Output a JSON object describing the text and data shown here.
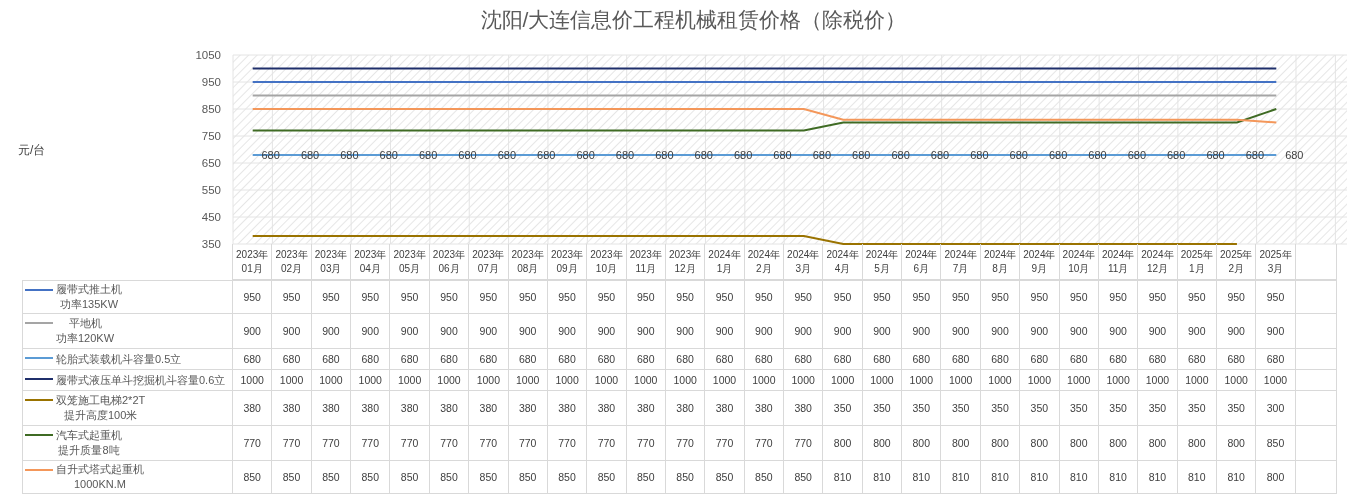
{
  "chart": {
    "chart_data": {
      "type": "line",
      "title": "沈阳/大连信息价工程机械租赁价格（除税价）",
      "annotations": [
        {
          "text": "元/台"
        }
      ],
      "ylim": [
        350,
        1050
      ],
      "yticks": [
        350,
        450,
        550,
        650,
        750,
        850,
        950,
        1050
      ],
      "grid": true,
      "legend": "bottom",
      "categories": [
        "2023年\n01月",
        "2023年\n02月",
        "2023年\n03月",
        "2023年\n04月",
        "2023年\n05月",
        "2023年\n06月",
        "2023年\n07月",
        "2023年\n08月",
        "2023年\n09月",
        "2023年\n10月",
        "2023年\n11月",
        "2023年\n12月",
        "2024年\n1月",
        "2024年\n2月",
        "2024年\n3月",
        "2024年\n4月",
        "2024年\n5月",
        "2024年\n6月",
        "2024年\n7月",
        "2024年\n8月",
        "2024年\n9月",
        "2024年\n10月",
        "2024年\n11月",
        "2024年\n12月",
        "2025年\n1月",
        "2025年\n2月",
        "2025年\n3月"
      ],
      "series": [
        {
          "name": "履带式推土机",
          "color": "#4472c4",
          "values": [
            950,
            950,
            950,
            950,
            950,
            950,
            950,
            950,
            950,
            950,
            950,
            950,
            950,
            950,
            950,
            950,
            950,
            950,
            950,
            950,
            950,
            950,
            950,
            950,
            950,
            950,
            950
          ]
        },
        {
          "name": "平地机",
          "color": "#a5a5a5",
          "values": [
            900,
            900,
            900,
            900,
            900,
            900,
            900,
            900,
            900,
            900,
            900,
            900,
            900,
            900,
            900,
            900,
            900,
            900,
            900,
            900,
            900,
            900,
            900,
            900,
            900,
            900,
            900
          ]
        },
        {
          "name": "轮胎式装载机斗容量0.5立",
          "color": "#5b9bd5",
          "values": [
            680,
            680,
            680,
            680,
            680,
            680,
            680,
            680,
            680,
            680,
            680,
            680,
            680,
            680,
            680,
            680,
            680,
            680,
            680,
            680,
            680,
            680,
            680,
            680,
            680,
            680,
            680
          ],
          "value_labels": [
            "680",
            "680",
            "680",
            "680",
            "680",
            "680",
            "680",
            "680",
            "680",
            "680",
            "680",
            "680",
            "680",
            "680",
            "680",
            "680",
            "680",
            "680",
            "680",
            "680",
            "680",
            "680",
            "680",
            "680",
            "680",
            "680",
            "680"
          ]
        },
        {
          "name": "履带式液压单斗挖掘机斗容量0.6立",
          "color": "#1f2f6b",
          "values": [
            1000,
            1000,
            1000,
            1000,
            1000,
            1000,
            1000,
            1000,
            1000,
            1000,
            1000,
            1000,
            1000,
            1000,
            1000,
            1000,
            1000,
            1000,
            1000,
            1000,
            1000,
            1000,
            1000,
            1000,
            1000,
            1000,
            1000
          ]
        },
        {
          "name": "双笼施工电梯2*2T",
          "color": "#9a7300",
          "values": [
            380,
            380,
            380,
            380,
            380,
            380,
            380,
            380,
            380,
            380,
            380,
            380,
            380,
            380,
            380,
            350,
            350,
            350,
            350,
            350,
            350,
            350,
            350,
            350,
            350,
            350,
            null
          ]
        },
        {
          "name": "汽车式起重机",
          "color": "#3f6b24",
          "values": [
            770,
            770,
            770,
            770,
            770,
            770,
            770,
            770,
            770,
            770,
            770,
            770,
            770,
            770,
            770,
            800,
            800,
            800,
            800,
            800,
            800,
            800,
            800,
            800,
            800,
            800,
            850
          ]
        },
        {
          "name": "自升式塔式起重机",
          "color": "#f4975a",
          "values": [
            850,
            850,
            850,
            850,
            850,
            850,
            850,
            850,
            850,
            850,
            850,
            850,
            850,
            850,
            850,
            810,
            810,
            810,
            810,
            810,
            810,
            810,
            810,
            810,
            810,
            810,
            800
          ]
        }
      ]
    }
  },
  "data_table": {
    "rows": [
      {
        "note": "功率135KW",
        "cells": [
          "950",
          "950",
          "950",
          "950",
          "950",
          "950",
          "950",
          "950",
          "950",
          "950",
          "950",
          "950",
          "950",
          "950",
          "950",
          "950",
          "950",
          "950",
          "950",
          "950",
          "950",
          "950",
          "950",
          "950",
          "950",
          "950",
          "950"
        ]
      },
      {
        "note": "功率120KW",
        "cells": [
          "900",
          "900",
          "900",
          "900",
          "900",
          "900",
          "900",
          "900",
          "900",
          "900",
          "900",
          "900",
          "900",
          "900",
          "900",
          "900",
          "900",
          "900",
          "900",
          "900",
          "900",
          "900",
          "900",
          "900",
          "900",
          "900",
          "900"
        ]
      },
      {
        "cells": [
          "680",
          "680",
          "680",
          "680",
          "680",
          "680",
          "680",
          "680",
          "680",
          "680",
          "680",
          "680",
          "680",
          "680",
          "680",
          "680",
          "680",
          "680",
          "680",
          "680",
          "680",
          "680",
          "680",
          "680",
          "680",
          "680",
          "680"
        ]
      },
      {
        "cells": [
          "1000",
          "1000",
          "1000",
          "1000",
          "1000",
          "1000",
          "1000",
          "1000",
          "1000",
          "1000",
          "1000",
          "1000",
          "1000",
          "1000",
          "1000",
          "1000",
          "1000",
          "1000",
          "1000",
          "1000",
          "1000",
          "1000",
          "1000",
          "1000",
          "1000",
          "1000",
          "1000"
        ]
      },
      {
        "note": "提升高度100米",
        "cells": [
          "380",
          "380",
          "380",
          "380",
          "380",
          "380",
          "380",
          "380",
          "380",
          "380",
          "380",
          "380",
          "380",
          "380",
          "380",
          "350",
          "350",
          "350",
          "350",
          "350",
          "350",
          "350",
          "350",
          "350",
          "350",
          "350",
          "300"
        ]
      },
      {
        "note": "提升质量8吨",
        "cells": [
          "770",
          "770",
          "770",
          "770",
          "770",
          "770",
          "770",
          "770",
          "770",
          "770",
          "770",
          "770",
          "770",
          "770",
          "770",
          "800",
          "800",
          "800",
          "800",
          "800",
          "800",
          "800",
          "800",
          "800",
          "800",
          "800",
          "850"
        ]
      },
      {
        "note": "1000KN.M",
        "cells": [
          "850",
          "850",
          "850",
          "850",
          "850",
          "850",
          "850",
          "850",
          "850",
          "850",
          "850",
          "850",
          "850",
          "850",
          "850",
          "810",
          "810",
          "810",
          "810",
          "810",
          "810",
          "810",
          "810",
          "810",
          "810",
          "810",
          "800"
        ]
      }
    ]
  }
}
